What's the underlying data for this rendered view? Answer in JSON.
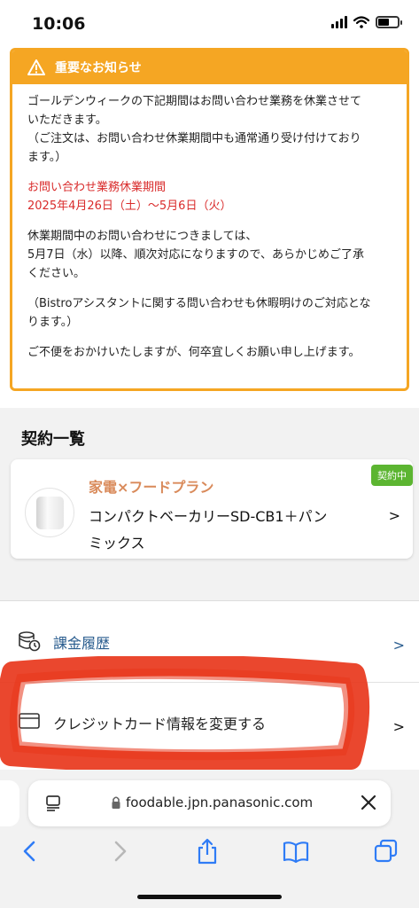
{
  "status_bar": {
    "time": "10:06"
  },
  "notice": {
    "title": "重要なお知らせ",
    "paragraph1_line1": "ゴールデンウィークの下記期間はお問い合わせ業務を休業させて",
    "paragraph1_line2": "いただきます。",
    "paragraph1_line3": "（ご注文は、お問い合わせ休業期間中も通常通り受け付けており",
    "paragraph1_line4": "ます。）",
    "period_label": "お問い合わせ業務休業期間",
    "period_dates": "2025年4月26日（土）〜5月6日（火）",
    "paragraph2_line1": "休業期間中のお問い合わせにつきましては、",
    "paragraph2_line2": "5月7日（水）以降、順次対応になりますので、あらかじめご了承",
    "paragraph2_line3": "ください。",
    "paragraph3_line1": "（Bistroアシスタントに関する問い合わせも休暇明けのご対応とな",
    "paragraph3_line2": "ります。）",
    "paragraph4": "ご不便をおかけいたしますが、何卒宜しくお願い申し上げます。"
  },
  "contracts": {
    "title": "契約一覧",
    "card": {
      "badge": "契約中",
      "plan_label": "家電×フードプラン",
      "product_line1": "コンパクトベーカリーSD-CB1＋パン",
      "product_line2": "ミックス",
      "arrow": ">"
    }
  },
  "menu": {
    "billing_history": "課金履歴",
    "change_card": "クレジットカード情報を変更する",
    "arrow": ">"
  },
  "browser": {
    "url": "foodable.jpn.panasonic.com"
  },
  "colors": {
    "notice_orange": "#f5a623",
    "badge_green": "#5cb531",
    "alert_red": "#d92b2b",
    "scribble_red": "#e8371c"
  }
}
